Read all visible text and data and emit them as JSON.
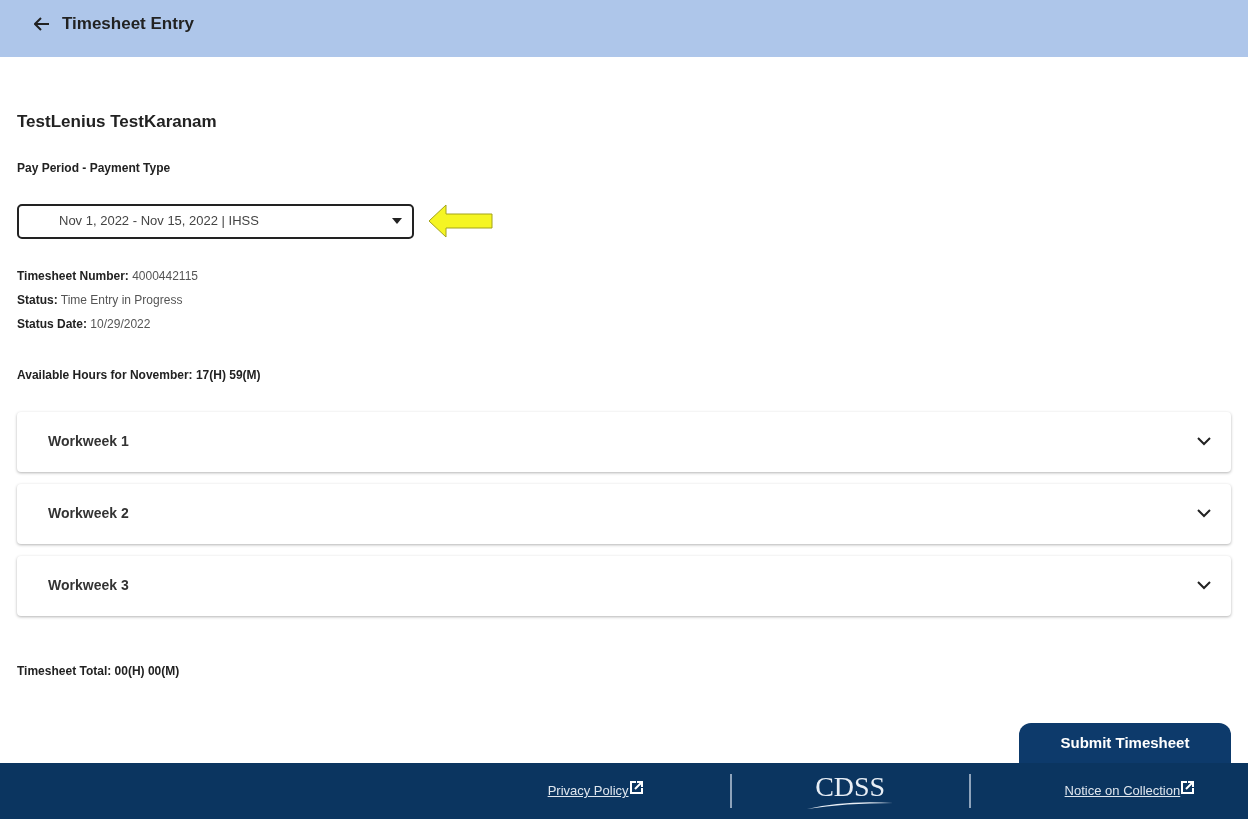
{
  "header": {
    "title": "Timesheet Entry"
  },
  "provider_name": "TestLenius TestKaranam",
  "pay_period": {
    "label": "Pay Period - Payment Type",
    "value": "Nov 1, 2022 - Nov 15, 2022 | IHSS"
  },
  "details": [
    {
      "label": "Timesheet Number:",
      "value": "4000442115"
    },
    {
      "label": "Status:",
      "value": "Time Entry in Progress"
    },
    {
      "label": "Status Date:",
      "value": "10/29/2022"
    }
  ],
  "available_hours": "Available Hours for November: 17(H) 59(M)",
  "workweeks": [
    {
      "title": "Workweek 1",
      "expanded": false
    },
    {
      "title": "Workweek 2",
      "expanded": false
    },
    {
      "title": "Workweek 3",
      "expanded": false
    }
  ],
  "timesheet_total": "Timesheet Total: 00(H) 00(M)",
  "submit_button": "Submit Timesheet",
  "footer": {
    "links": [
      "Privacy Policy",
      "Notice on Collection"
    ],
    "logo": "CDSS"
  }
}
